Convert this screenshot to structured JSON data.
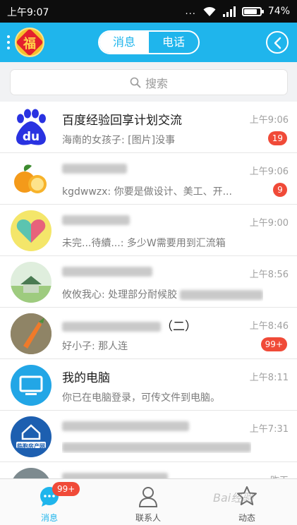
{
  "status_bar": {
    "time": "上午9:07",
    "battery": "74%",
    "battery_level": 0.74,
    "dots": "..."
  },
  "header": {
    "self_avatar_char": "福",
    "tabs": [
      {
        "label": "消息"
      },
      {
        "label": "电话"
      }
    ]
  },
  "search": {
    "placeholder": "搜索"
  },
  "conversations": [
    {
      "name": "百度经验回享计划交流",
      "message": "海南的女孩子: [图片]没事",
      "time": "上午9:06",
      "badge": "19"
    },
    {
      "name": "",
      "message": "kgdwwzx: 你要是做设计、美工、开...",
      "time": "上午9:06",
      "badge": "9"
    },
    {
      "name": "",
      "message": "未完...待續...: 多少W需要用到汇流箱",
      "time": "上午9:00",
      "badge": ""
    },
    {
      "name": "",
      "message": "攸攸我心: 处理部分耐候胶",
      "time": "上午8:56",
      "badge": ""
    },
    {
      "name": "（二）",
      "message": "好小子: 那人连",
      "time": "上午8:46",
      "badge": "99+"
    },
    {
      "name": "我的电脑",
      "message": "你已在电脑登录，可传文件到电脑。",
      "time": "上午8:11",
      "badge": ""
    },
    {
      "name": "",
      "message": "",
      "time": "上午7:31",
      "badge": "",
      "logo_text": "临朐房产网"
    },
    {
      "name": "",
      "message": "",
      "time": "昨天",
      "badge": ""
    }
  ],
  "bottom_nav": {
    "items": [
      {
        "label": "消息",
        "badge": "99+"
      },
      {
        "label": "联系人"
      },
      {
        "label": "动态"
      }
    ]
  },
  "watermark": "Bai经验",
  "colors": {
    "accent": "#1fb5ec",
    "badge": "#f04a38"
  }
}
